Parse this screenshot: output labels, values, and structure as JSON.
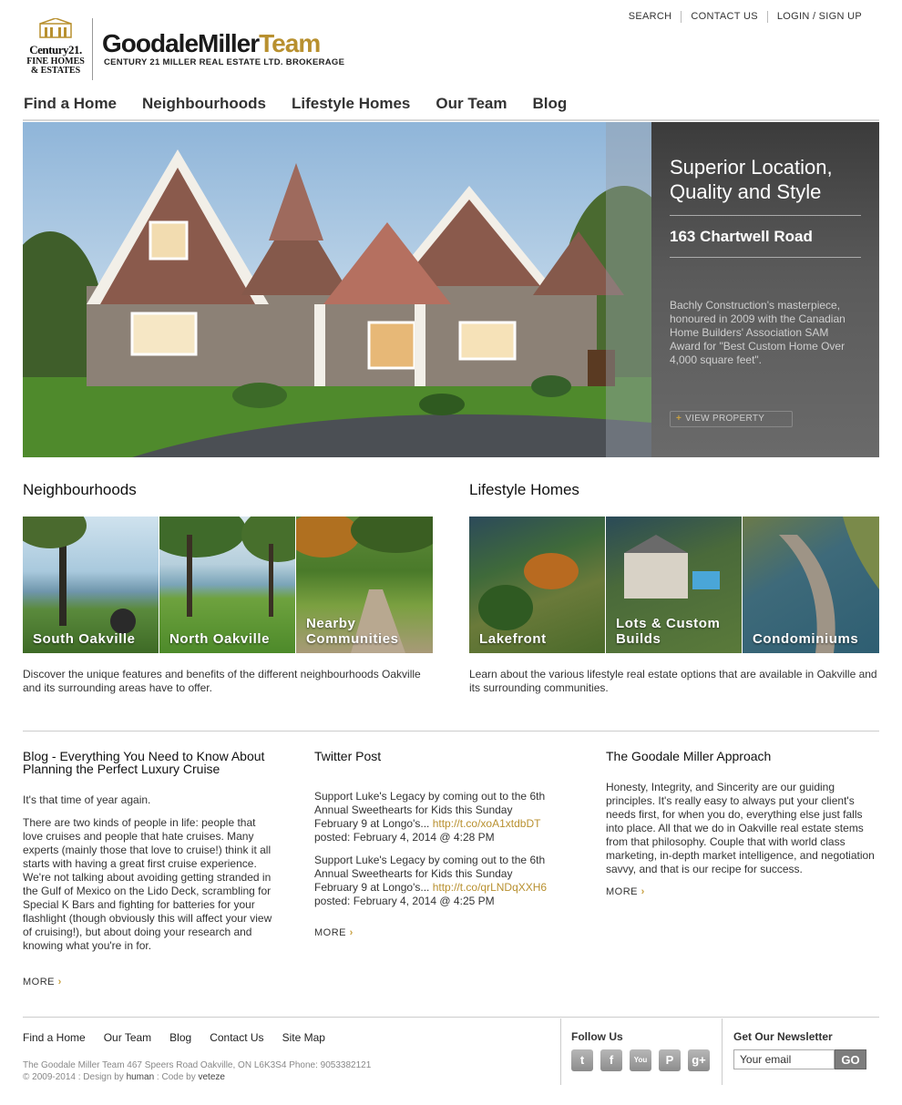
{
  "utility": [
    "SEARCH",
    "CONTACT US",
    "LOGIN / SIGN UP"
  ],
  "logo": {
    "c21_word": "Century21.",
    "c21_line1": "FINE HOMES",
    "c21_line2": "& ESTATES",
    "brand_dark": "GoodaleMiller",
    "brand_gold": "Team",
    "brand_sub": "CENTURY 21 MILLER REAL ESTATE LTD. BROKERAGE"
  },
  "nav": [
    "Find a Home",
    "Neighbourhoods",
    "Lifestyle Homes",
    "Our Team",
    "Blog"
  ],
  "hero": {
    "title": "Superior Location, Quality and Style",
    "address": "163 Chartwell Road",
    "description": "Bachly Construction's masterpiece, honoured in 2009 with the Canadian Home Builders' Association SAM Award for \"Best Custom Home Over 4,000 square feet\".",
    "button_plus": "+",
    "button": "VIEW PROPERTY"
  },
  "neighbourhoods": {
    "title": "Neighbourhoods",
    "tiles": [
      "South Oakville",
      "North Oakville",
      "Nearby Communities"
    ],
    "description": "Discover the unique features and benefits of the different neighbourhoods Oakville and its surrounding areas have to offer."
  },
  "lifestyle": {
    "title": "Lifestyle Homes",
    "tiles": [
      "Lakefront",
      "Lots & Custom Builds",
      "Condominiums"
    ],
    "description": "Learn about the various lifestyle real estate options that are available in Oakville and its surrounding communities."
  },
  "blog": {
    "title": "Blog - Everything You Need to Know About Planning the Perfect Luxury Cruise",
    "intro": "It's that time of year again.",
    "body": "There are two kinds of people in life: people that love cruises and people that hate cruises. Many experts (mainly those that love to cruise!) think it all starts with having a great first cruise experience. We're not talking about avoiding getting stranded in the Gulf of Mexico on the Lido Deck, scrambling for Special K Bars and fighting for batteries for your flashlight (though obviously this will affect your view of cruising!), but about doing your research and knowing what you're in for.",
    "more": "MORE"
  },
  "twitter": {
    "title": "Twitter Post",
    "posts": [
      {
        "text": "Support Luke's Legacy by coming out to the 6th Annual Sweethearts for Kids this Sunday February 9 at Longo's...",
        "link": "http://t.co/xoA1xtdbDT",
        "posted": "posted: February 4, 2014 @ 4:28 PM"
      },
      {
        "text": "Support Luke's Legacy by coming out to the 6th Annual Sweethearts for Kids this Sunday February 9 at Longo's...",
        "link": "http://t.co/qrLNDqXXH6",
        "posted": "posted: February 4, 2014 @ 4:25 PM"
      }
    ],
    "more": "MORE"
  },
  "approach": {
    "title": "The Goodale Miller Approach",
    "body": "Honesty, Integrity, and Sincerity are our guiding principles. It's really easy to always put your client's needs first, for when you do, everything else just falls into place. All that we do in Oakville real estate stems from that philosophy. Couple that with world class marketing, in-depth market intelligence, and negotiation savvy, and that is our recipe for success.",
    "more": "MORE"
  },
  "footer": {
    "nav": [
      "Find a Home",
      "Our Team",
      "Blog",
      "Contact Us",
      "Site Map"
    ],
    "address": "The Goodale Miller Team 467 Speers Road Oakville, ON L6K3S4 Phone: 9053382121",
    "copyright_prefix": "© 2009-2014 : Design by ",
    "design_by": "human",
    "code_prefix": " : Code by ",
    "code_by": "veteze",
    "follow_title": "Follow Us",
    "social": [
      {
        "name": "twitter-icon",
        "glyph": "t"
      },
      {
        "name": "facebook-icon",
        "glyph": "f"
      },
      {
        "name": "youtube-icon",
        "glyph": "You"
      },
      {
        "name": "pinterest-icon",
        "glyph": "P"
      },
      {
        "name": "google-plus-icon",
        "glyph": "g+"
      }
    ],
    "newsletter_title": "Get Our Newsletter",
    "email_placeholder": "Your email",
    "go": "GO"
  },
  "colors": {
    "gold": "#b8902f",
    "dark_panel": "#4a4a4a",
    "nav_text": "#333333"
  }
}
